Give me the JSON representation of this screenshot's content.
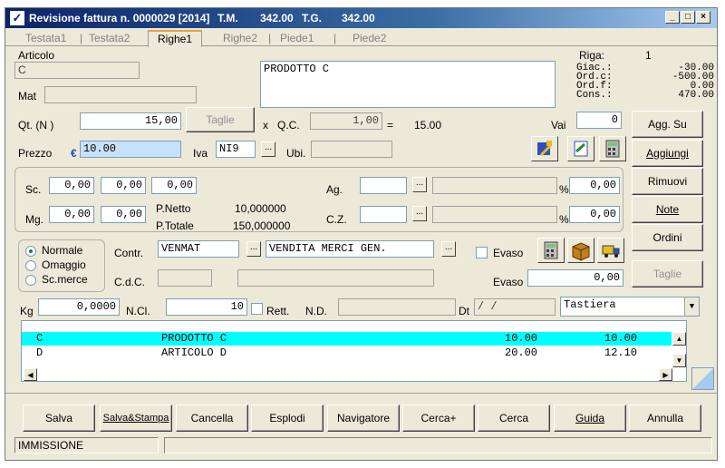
{
  "title": {
    "prefix": "Revisione fattura n. 0000029 [2014]",
    "tm_label": "T.M.",
    "tm_value": "342.00",
    "tg_label": "T.G.",
    "tg_value": "342.00"
  },
  "titlebar_buttons": [
    "_",
    "□",
    "×"
  ],
  "tabs": [
    "Testata1",
    "Testata2",
    "Righe1",
    "Righe2",
    "Piede1",
    "Piede2"
  ],
  "tab_separator": "|",
  "articolo": {
    "label": "Articolo",
    "code": "C",
    "description": "PRODOTTO C",
    "mat_label": "Mat"
  },
  "riga": {
    "label": "Riga:",
    "value": "1"
  },
  "stock": {
    "giac_label": "Giac.:",
    "giac": "-30.00",
    "ordc_label": "Ord.c:",
    "ordc": "-500.00",
    "ordf_label": "Ord.f:",
    "ordf": "0.00",
    "cons_label": "Cons.:",
    "cons": "470.00"
  },
  "qty": {
    "label": "Qt.  (N )",
    "value": "15,00",
    "taglie_label": "Taglie",
    "x_label": "x",
    "qc_label": "Q.C.",
    "qc_value": "1,00",
    "eq": "=",
    "total": "15.00"
  },
  "vai": {
    "label": "Vai",
    "value": "0"
  },
  "prezzo": {
    "label": "Prezzo",
    "currency": "€",
    "value": "10.00",
    "iva_label": "Iva",
    "iva_value": "NI9",
    "dots": "...",
    "ubi_label": "Ubi."
  },
  "discounts": {
    "sc_label": "Sc.",
    "sc": [
      "0,00",
      "0,00",
      "0,00"
    ],
    "mg_label": "Mg.",
    "mg": [
      "0,00",
      "0,00"
    ],
    "pnetto_label": "P.Netto",
    "pnetto": "10,000000",
    "ptotale_label": "P.Totale",
    "ptotale": "150,000000",
    "ag_label": "Ag.",
    "ag_pct": "0,00",
    "cz_label": "C.Z.",
    "cz_pct": "0,00",
    "pct": "%"
  },
  "tipo": {
    "options": [
      "Normale",
      "Omaggio",
      "Sc.merce"
    ],
    "selected": "Normale"
  },
  "contr": {
    "label": "Contr.",
    "code": "VENMAT",
    "description": "VENDITA MERCI GEN.",
    "evaso_label": "Evaso",
    "cdc_label": "C.d.C.",
    "evaso2_label": "Evaso",
    "evaso_value": "0,00"
  },
  "bottom_fields": {
    "kg_label": "Kg",
    "kg": "0,0000",
    "ncl_label": "N.Cl.",
    "ncl": "10",
    "rett_label": "Rett.",
    "nd_label": "N.D.",
    "dt_label": "Dt",
    "dt": " /  /",
    "tastiera": "Tastiera"
  },
  "side_buttons": [
    "Agg. Su",
    "Aggiungi",
    "Rimuovi",
    "Note",
    "Ordini",
    "Taglie"
  ],
  "rows": [
    {
      "code": "C",
      "description": "PRODOTTO C",
      "qty": "10.00",
      "price": "10.00"
    },
    {
      "code": "D",
      "description": "ARTICOLO D",
      "qty": "20.00",
      "price": "12.10"
    }
  ],
  "footer_buttons": [
    "Salva",
    "Salva&Stampa",
    "Cancella",
    "Esplodi",
    "Navigatore",
    "Cerca+",
    "Cerca",
    "Guida",
    "Annulla"
  ],
  "status": {
    "mode": "IMMISSIONE",
    "message": ""
  },
  "icons": {
    "tb1": "export-icon",
    "tb2": "notes-icon",
    "tb3": "calculator-icon",
    "tb4": "calculator-icon",
    "tb5": "box-icon",
    "tb6": "truck-icon"
  }
}
